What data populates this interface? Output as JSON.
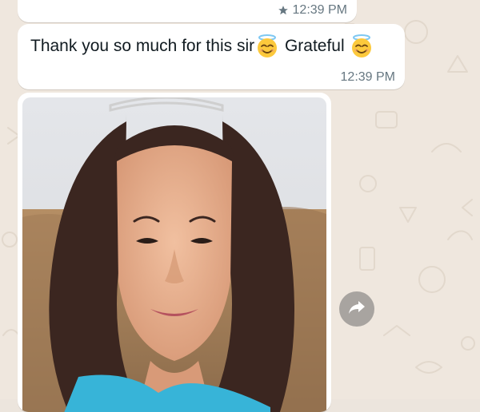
{
  "messages": [
    {
      "id": "prev",
      "time": "12:39 PM",
      "starred": true
    },
    {
      "id": "thanks",
      "text_part1": "Thank you so much for this sir",
      "emoji1": "smiling-face-with-halo",
      "text_part2": " Grateful ",
      "emoji2": "smiling-face-with-halo",
      "time": "12:39 PM"
    },
    {
      "id": "photo",
      "type": "image"
    }
  ],
  "colors": {
    "wallpaper": "#efe7de",
    "bubble": "#ffffff",
    "meta_text": "#667781",
    "message_text": "#111b21"
  },
  "icons": {
    "star": "star-icon",
    "forward": "forward-icon",
    "emoji": "smiling-face-with-halo-icon"
  }
}
